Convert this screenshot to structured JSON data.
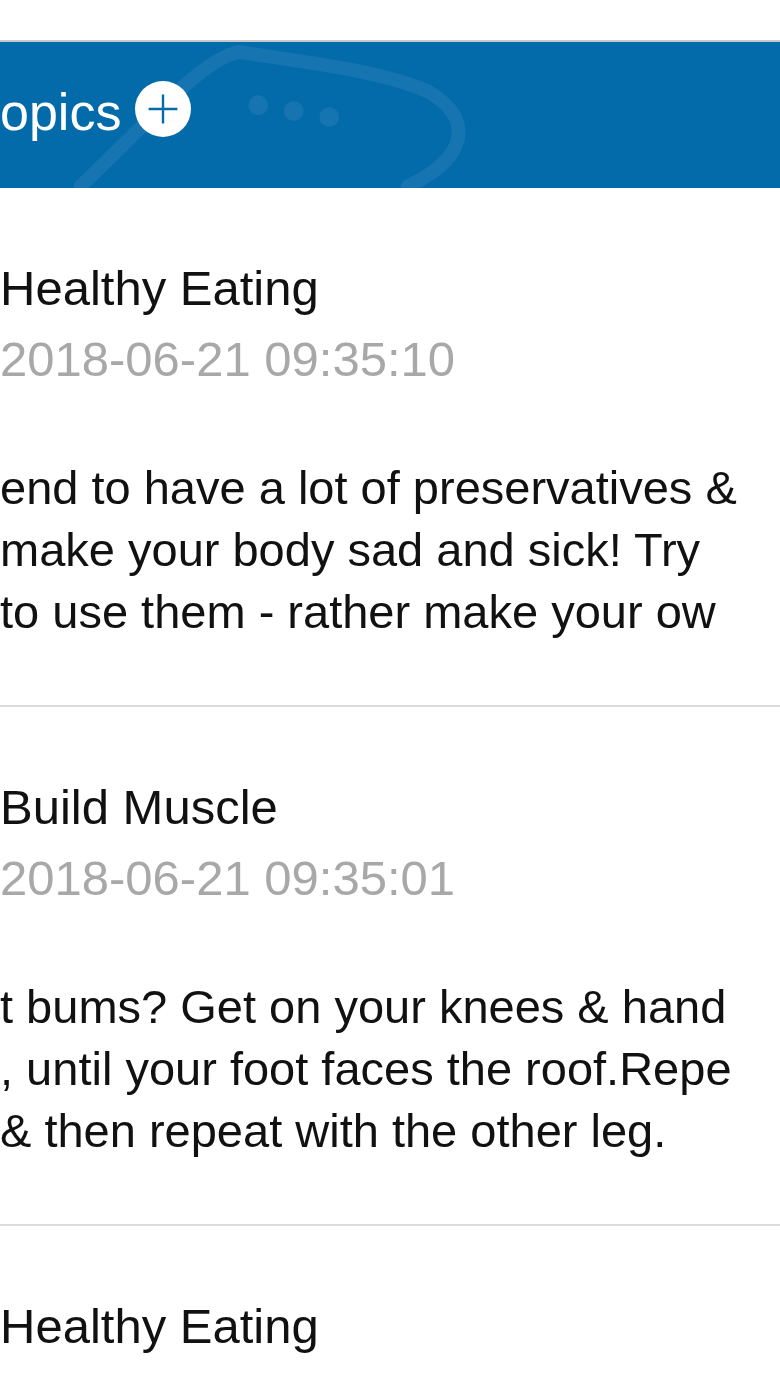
{
  "header": {
    "title": "opics"
  },
  "posts": [
    {
      "category": "Healthy Eating",
      "timestamp": "2018-06-21 09:35:10",
      "body_lines": [
        "end to have a lot of preservatives &",
        "make your body sad and sick! Try",
        "to use them - rather make your ow"
      ]
    },
    {
      "category": "Build Muscle",
      "timestamp": "2018-06-21 09:35:01",
      "body_lines": [
        "t bums? Get on your knees & hand",
        ", until your foot faces the roof.Repe",
        "& then repeat with the other leg."
      ]
    },
    {
      "category": "Healthy Eating"
    }
  ]
}
